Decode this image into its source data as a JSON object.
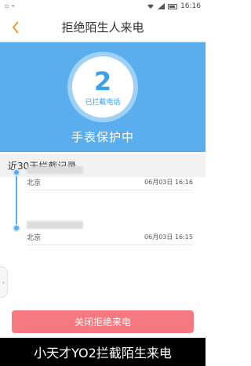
{
  "status_bar": {
    "time": "16:16"
  },
  "nav": {
    "title": "拒绝陌生人来电"
  },
  "hero": {
    "count": "2",
    "count_label": "已拦截电话",
    "status_text": "手表保护中"
  },
  "section": {
    "title": "近30天拦截记录"
  },
  "records": [
    {
      "city": "北京",
      "time": "06月03日 16:16"
    },
    {
      "city": "北京",
      "time": "06月03日 16:15"
    }
  ],
  "actions": {
    "close_label": "关闭拒绝来电"
  },
  "caption": {
    "text": "小天才YO2拦截陌生来电"
  },
  "colors": {
    "accent": "#5aaeee",
    "button": "#f67880",
    "back_arrow": "#f39a2e"
  }
}
